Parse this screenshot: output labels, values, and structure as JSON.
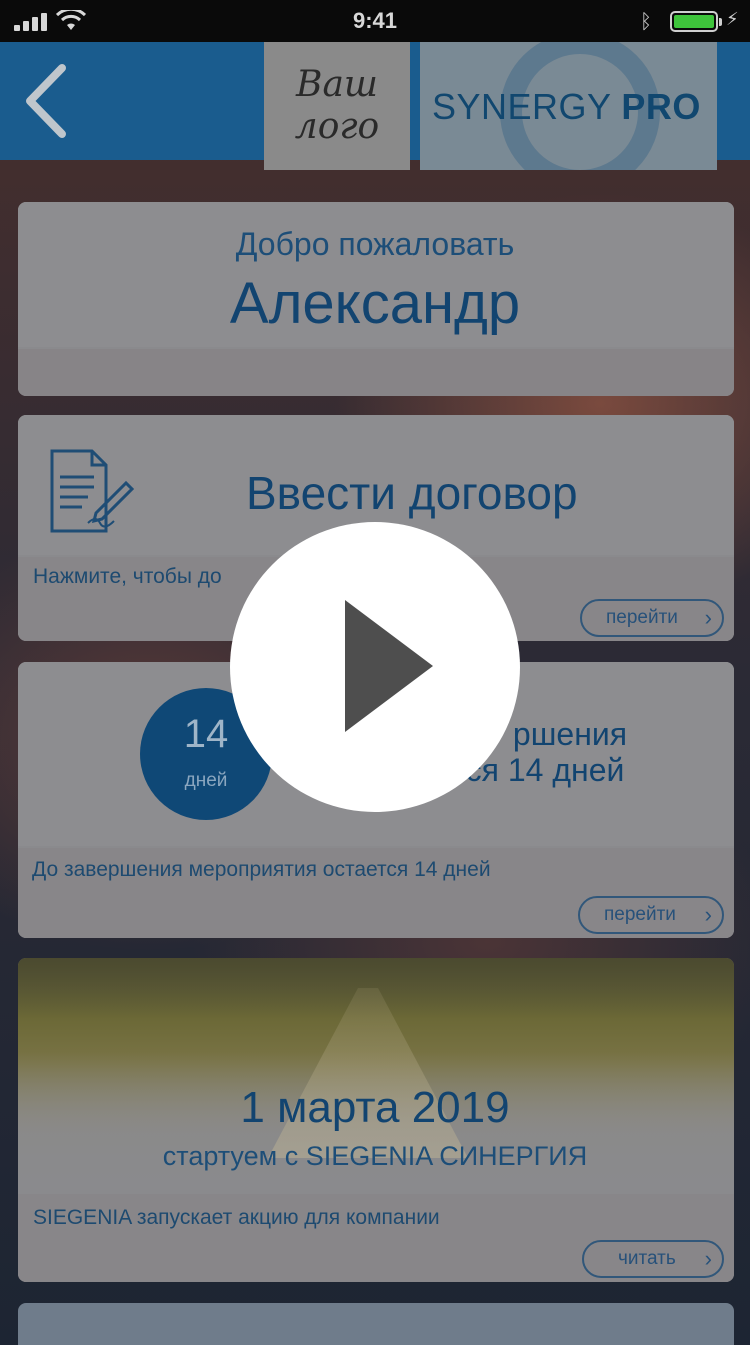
{
  "status_bar": {
    "time": "9:41"
  },
  "brand": {
    "logo_placeholder_line1": "Ваш",
    "logo_placeholder_line2": "лого",
    "app_name_part1": "SYNERGY",
    "app_name_part2": "PRO"
  },
  "welcome": {
    "label": "Добро пожаловать",
    "name": "Александр"
  },
  "contract": {
    "title": "Ввести договор",
    "subtitle": "Нажмите, чтобы до",
    "button": "перейти"
  },
  "event": {
    "days_value": "14",
    "days_unit": "дней",
    "title_line1": "ршения",
    "title_line2": "ся 14 дней",
    "subtitle": "До завершения мероприятия остается 14 дней",
    "button": "перейти"
  },
  "news": {
    "date": "1 марта 2019",
    "title": "стартуем с SIEGENIA СИНЕРГИЯ",
    "subtitle": "SIEGENIA запускает акцию для компании",
    "button": "читать"
  },
  "colors": {
    "nav_bar": "#1a5c8e",
    "accent_text": "#124470",
    "play_button": "#ffffff",
    "battery": "#3ec43b"
  }
}
